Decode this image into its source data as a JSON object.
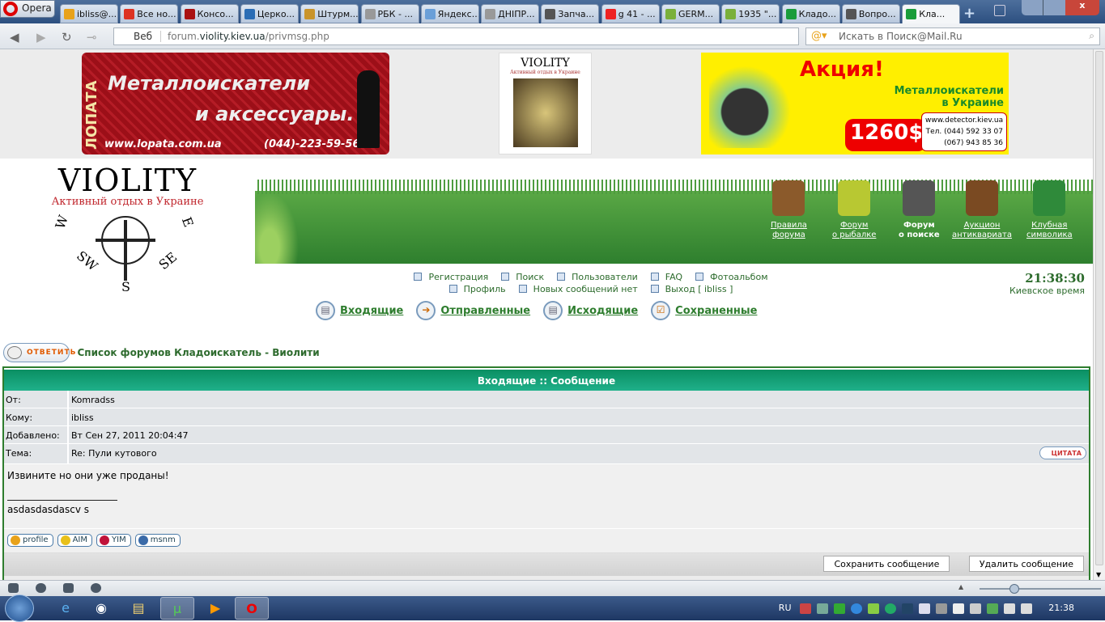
{
  "browser": {
    "menu_label": "Opera",
    "tabs": [
      {
        "label": "ibliss@...",
        "color": "#e8a21a"
      },
      {
        "label": "Все но...",
        "color": "#d32"
      },
      {
        "label": "Консо...",
        "color": "#a11"
      },
      {
        "label": "Церко...",
        "color": "#2a6db5"
      },
      {
        "label": "Штурм...",
        "color": "#c9942a"
      },
      {
        "label": "РБК - ...",
        "color": "#999"
      },
      {
        "label": "Яндекс...",
        "color": "#6a9fd8"
      },
      {
        "label": "ДНІПР...",
        "color": "#999"
      },
      {
        "label": "Запча...",
        "color": "#555"
      },
      {
        "label": "g 41 - ...",
        "color": "#e22"
      },
      {
        "label": "GERM...",
        "color": "#7ab03a"
      },
      {
        "label": "1935 \"...",
        "color": "#7ab03a"
      },
      {
        "label": "Кладо...",
        "color": "#1a9c3a"
      },
      {
        "label": "Вопро...",
        "color": "#555"
      },
      {
        "label": "Кла...",
        "color": "#1a9c3a"
      }
    ],
    "address_prefix": "Веб",
    "url_pre": "forum.",
    "url_domain": "violity.kiev.ua",
    "url_path": "/privmsg.php",
    "search_placeholder": "Искать в Поиск@Mail.Ru"
  },
  "ads": {
    "lopata": {
      "brand": "ЛОПАТА",
      "line1": "Металлоискатели",
      "line2": "и аксессуары.",
      "site": "www.lopata.com.ua",
      "phone": "(044)-223-59-56"
    },
    "magazine": {
      "title": "VIOLITY",
      "subtitle": "Активный отдых в Украине"
    },
    "detector": {
      "promo": "Акция!",
      "line1": "Металлоискатели",
      "line2": "в Украине",
      "price": "1260$",
      "site": "www.detector.kiev.ua",
      "phone1": "Тел. (044) 592 33 07",
      "phone2": "(067) 943 85 36"
    }
  },
  "header": {
    "logo": "VIOLITY",
    "tagline": "Активный отдых в Украине",
    "compass": {
      "w": "W",
      "e": "E",
      "sw": "SW",
      "se": "SE",
      "s": "S"
    },
    "nav": [
      {
        "line1": "Правила",
        "line2": "форума",
        "color": "#8b5a2b"
      },
      {
        "line1": "Форум",
        "line2": "о рыбалке",
        "color": "#b8c832"
      },
      {
        "line1": "Форум",
        "line2": "о поиске",
        "color": "#555"
      },
      {
        "line1": "Аукцион",
        "line2": "антиквариата",
        "color": "#7a4a22"
      },
      {
        "line1": "Клубная",
        "line2": "символика",
        "color": "#2f8a3a"
      }
    ]
  },
  "links": {
    "row1": [
      "Регистрация",
      "Поиск",
      "Пользователи",
      "FAQ",
      "Фотоальбом"
    ],
    "row2": [
      "Профиль",
      "Новых сообщений нет",
      "Выход [ ibliss ]"
    ]
  },
  "clock": {
    "time": "21:38:30",
    "label": "Киевское время"
  },
  "pm_nav": [
    "Входящие",
    "Отправленные",
    "Исходящие",
    "Сохраненные"
  ],
  "reply_label": "ОТВЕТИТЬ",
  "breadcrumb": "Список форумов Кладоискатель - Виолити",
  "message": {
    "title": "Входящие :: Сообщение",
    "fields": [
      {
        "label": "От:",
        "value": "Komradss"
      },
      {
        "label": "Кому:",
        "value": "ibliss"
      },
      {
        "label": "Добавлено:",
        "value": "Вт Сен 27, 2011 20:04:47"
      },
      {
        "label": "Тема:",
        "value": "Re: Пули кутового"
      }
    ],
    "quote_label": "ЦИТАТА",
    "body": "Извините но они уже проданы!",
    "signature": "asdasdasdascv s",
    "contacts": [
      "profile",
      "AIM",
      "YIM",
      "msnm"
    ],
    "save_label": "Сохранить сообщение",
    "delete_label": "Удалить сообщение"
  },
  "taskbar": {
    "lang": "RU",
    "time": "21:38"
  }
}
